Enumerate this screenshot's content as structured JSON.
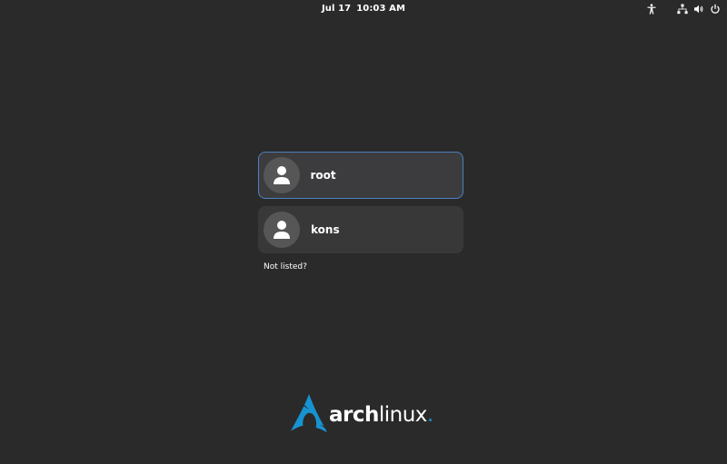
{
  "topbar": {
    "date": "Jul 17",
    "time": "10:03 AM",
    "indicators": [
      "accessibility-icon",
      "network-wired-icon",
      "volume-icon",
      "power-icon"
    ]
  },
  "users": [
    {
      "name": "root",
      "selected": true,
      "icon": "user-avatar-icon"
    },
    {
      "name": "kons",
      "selected": false,
      "icon": "user-avatar-icon"
    }
  ],
  "not_listed": "Not listed?",
  "logo": {
    "word_bold": "arch",
    "word_light": "linux",
    "dot": ".",
    "brand_color": "#1793d1"
  },
  "colors": {
    "background": "#2a2a2a",
    "card": "#383838",
    "selection_border": "#4a82bf"
  }
}
